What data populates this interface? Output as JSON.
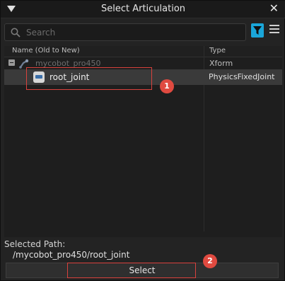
{
  "window": {
    "title": "Select Articulation"
  },
  "search": {
    "placeholder": "Search"
  },
  "tree": {
    "columns": {
      "name": "Name (Old to New)",
      "type": "Type"
    },
    "rows": [
      {
        "name": "mycobot_pro450",
        "type": "Xform",
        "icon": "robot-articulation-icon"
      },
      {
        "name": "root_joint",
        "type": "PhysicsFixedJoint",
        "icon": "joint-icon",
        "selected": true
      }
    ]
  },
  "footer": {
    "selected_label": "Selected Path:",
    "selected_path": "/mycobot_pro450/root_joint",
    "select_button": "Select"
  },
  "annotations": {
    "badge1": "1",
    "badge2": "2"
  },
  "colors": {
    "accent": "#1aa6d9",
    "annotation": "#d9423d",
    "selection": "#3a3a3a"
  }
}
